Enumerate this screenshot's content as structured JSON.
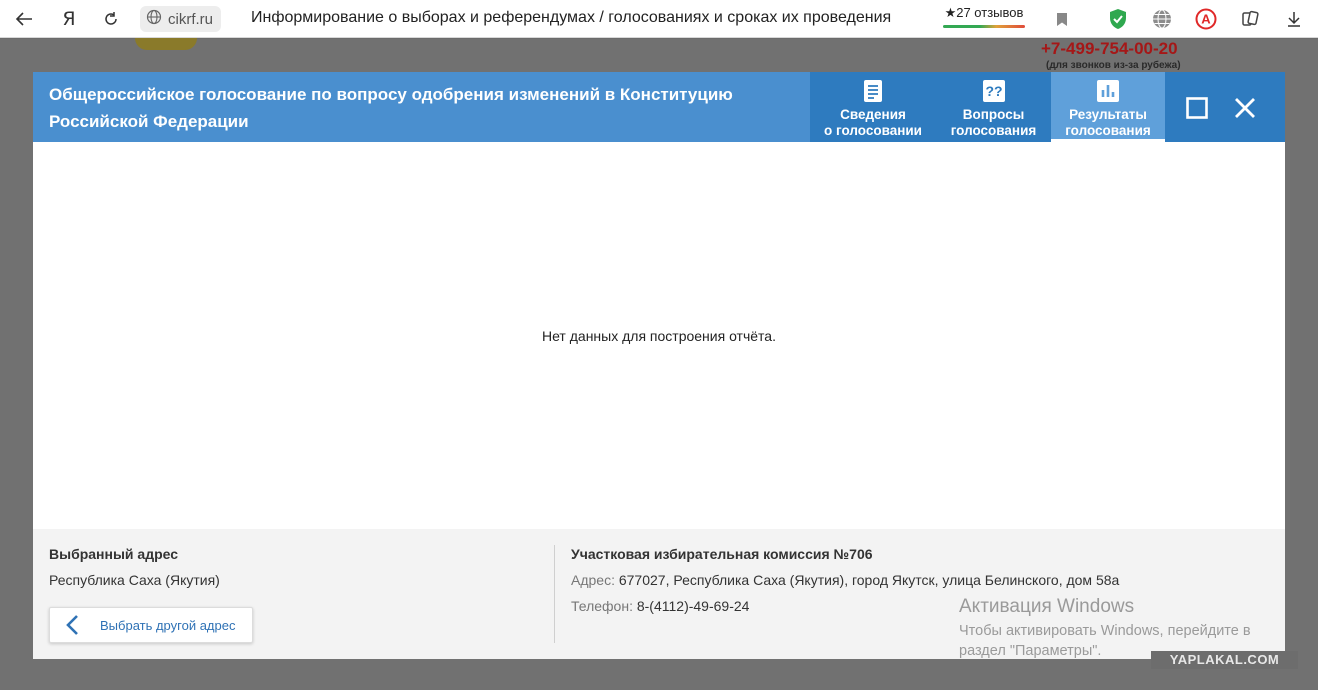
{
  "browser": {
    "domain": "cikrf.ru",
    "page_title": "Информирование о выборах и референдумах / голосованиях и сроках их проведения",
    "reviews": "★27 отзывов",
    "icons": [
      "back-arrow-icon",
      "yandex-logo-icon",
      "reload-icon",
      "site-globe-icon",
      "bookmark-icon",
      "shield-check-icon",
      "vpn-globe-icon",
      "adblock-icon",
      "collections-icon",
      "download-icon"
    ]
  },
  "background": {
    "phone": "+7-499-754-00-20",
    "phone_note": "(для звонков из-за рубежа)"
  },
  "modal": {
    "title": "Общероссийское голосование по вопросу одобрения изменений в Конституцию Российской Федерации",
    "tabs": [
      {
        "line1": "Сведения",
        "line2": "о голосовании",
        "icon": "document-icon"
      },
      {
        "line1": "Вопросы",
        "line2": "голосования",
        "icon": "questions-icon"
      },
      {
        "line1": "Результаты",
        "line2": "голосования",
        "icon": "bar-chart-icon",
        "active": true
      }
    ],
    "empty_message": "Нет данных для построения отчёта.",
    "footer": {
      "address_heading": "Выбранный адрес",
      "address_value": "Республика Саха (Якутия)",
      "change_address_button": "Выбрать другой адрес",
      "commission_heading": "Участковая избирательная комиссия №706",
      "address_label": "Адрес:",
      "address_full": "677027, Республика Саха (Якутия), город Якутск, улица Белинского, дом 58а",
      "phone_label": "Телефон:",
      "phone_value": "8-(4112)-49-69-24"
    }
  },
  "os_overlay": {
    "activation_title": "Активация Windows",
    "activation_line1": "Чтобы активировать Windows, перейдите в",
    "activation_line2": "раздел \"Параметры\"."
  },
  "watermark": "YAPLAKAL.COM",
  "colors": {
    "header_blue": "#4a8fcf",
    "tab_blue": "#2e7bbf",
    "active_tab": "#5fa0da",
    "phone_red": "#a51717"
  }
}
